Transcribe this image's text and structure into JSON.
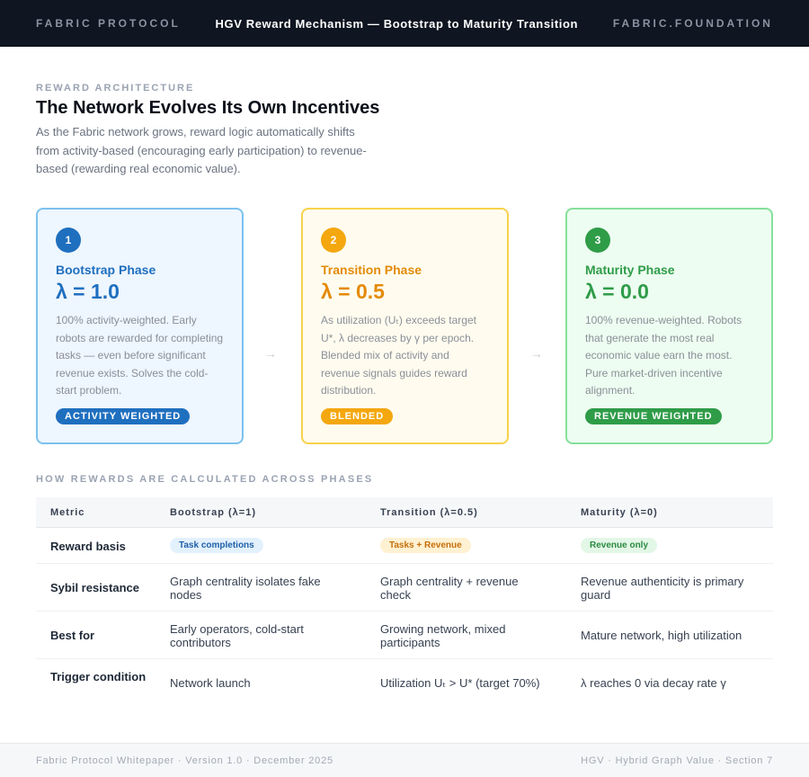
{
  "header": {
    "brand": "FABRIC PROTOCOL",
    "title": "HGV Reward Mechanism — Bootstrap to Maturity Transition",
    "site": "FABRIC.FOUNDATION"
  },
  "intro": {
    "eyebrow": "REWARD ARCHITECTURE",
    "heading": "The Network Evolves Its Own Incentives",
    "lead": "As the Fabric network grows, reward logic automatically shifts from activity-based (encouraging early participation) to revenue-based (rewarding real economic value)."
  },
  "phases": [
    {
      "number": "1",
      "name": "Bootstrap Phase",
      "lambda": "λ = 1.0",
      "description": "100% activity-weighted. Early robots are rewarded for completing tasks — even before significant revenue exists. Solves the cold-start problem.",
      "pill": "ACTIVITY WEIGHTED"
    },
    {
      "number": "2",
      "name": "Transition Phase",
      "lambda": "λ = 0.5",
      "description": "As utilization (Uₜ) exceeds target U*, λ decreases by γ per epoch. Blended mix of activity and revenue signals guides reward distribution.",
      "pill": "BLENDED"
    },
    {
      "number": "3",
      "name": "Maturity Phase",
      "lambda": "λ = 0.0",
      "description": "100% revenue-weighted. Robots that generate the most real economic value earn the most. Pure market-driven incentive alignment.",
      "pill": "REVENUE WEIGHTED"
    }
  ],
  "arrows": [
    "→",
    "→"
  ],
  "table": {
    "section_label": "HOW REWARDS ARE CALCULATED ACROSS PHASES",
    "headers": [
      "Metric",
      "Bootstrap (λ=1)",
      "Transition (λ=0.5)",
      "Maturity (λ=0)"
    ],
    "rows": [
      {
        "metric": "Reward basis",
        "bootstrap": "Task completions",
        "transition": "Tasks + Revenue",
        "maturity": "Revenue only"
      },
      {
        "metric": "Sybil resistance",
        "bootstrap": "Graph centrality isolates fake nodes",
        "transition": "Graph centrality + revenue check",
        "maturity": "Revenue authenticity is primary guard"
      },
      {
        "metric": "Best for",
        "bootstrap": "Early operators, cold-start contributors",
        "transition": "Growing network, mixed participants",
        "maturity": "Mature network, high utilization"
      },
      {
        "metric": "Trigger condition",
        "bootstrap": "Network launch",
        "transition": "Utilization Uₜ > U* (target 70%)",
        "maturity": "λ reaches 0 via decay rate γ"
      }
    ]
  },
  "footer": {
    "left": "Fabric Protocol Whitepaper · Version 1.0 · December 2025",
    "right": "HGV · Hybrid Graph Value · Section 7"
  },
  "colors": {
    "bootstrap": "#1f6fbf",
    "transition": "#f4a70e",
    "maturity": "#2f9c48",
    "header_bg": "#0f1521"
  }
}
